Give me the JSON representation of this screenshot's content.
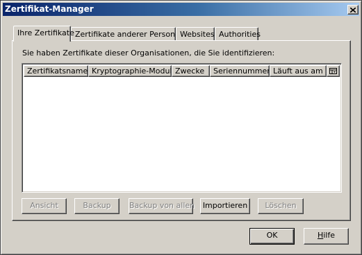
{
  "window": {
    "title": "Zertifikat-Manager"
  },
  "tabs": [
    {
      "label": "Ihre Zertifikate",
      "active": true
    },
    {
      "label": "Zertifikate anderer Personen",
      "active": false
    },
    {
      "label": "Websites",
      "active": false
    },
    {
      "label": "Authorities",
      "active": false
    }
  ],
  "panel": {
    "intro_text": "Sie haben Zertifikate dieser Organisationen, die Sie identifizieren:",
    "columns": [
      "Zertifikatsname",
      "Kryptographie-Modul",
      "Zwecke",
      "Seriennummer",
      "Läuft aus am"
    ],
    "rows": []
  },
  "actions": {
    "view": "Ansicht",
    "backup": "Backup",
    "backup_all": "Backup von allen",
    "import": "Importieren",
    "delete": "Löschen"
  },
  "footer": {
    "ok": "OK",
    "help_mnemonic": "H",
    "help_rest": "ilfe"
  },
  "icons": {
    "close": "close-icon",
    "column_picker": "column-picker-icon"
  },
  "colors": {
    "titlebar_start": "#0a246a",
    "titlebar_end": "#a6caf0",
    "face": "#d4d0c8",
    "disabled_text": "#808080"
  }
}
